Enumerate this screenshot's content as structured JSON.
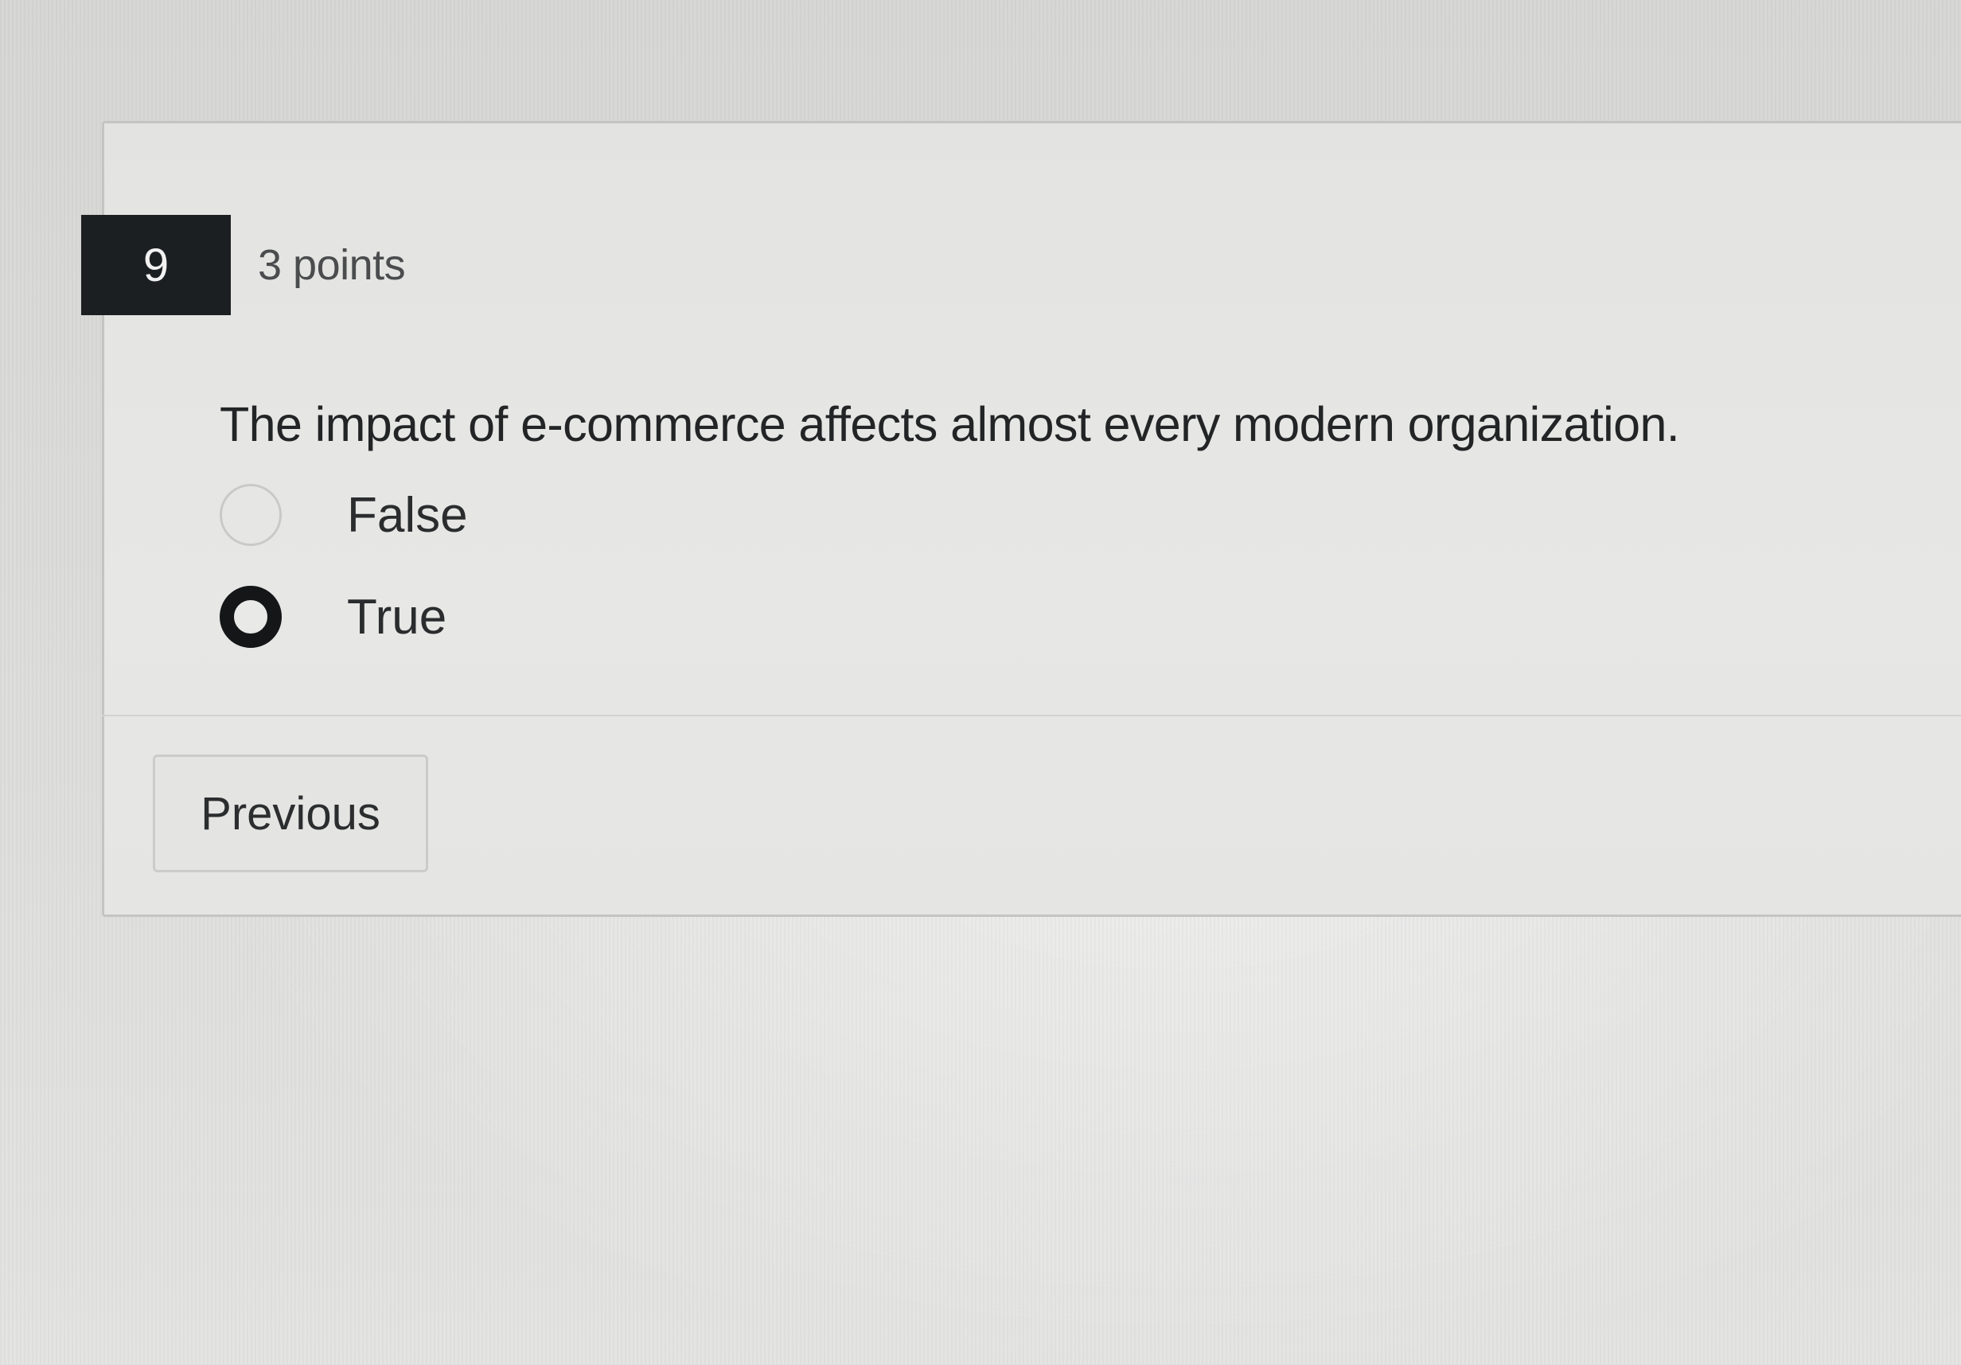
{
  "question": {
    "number": "9",
    "points": "3 points",
    "text": "The impact of e-commerce affects almost every modern organization.",
    "options": [
      {
        "label": "False",
        "selected": false
      },
      {
        "label": "True",
        "selected": true
      }
    ]
  },
  "navigation": {
    "previous_label": "Previous"
  },
  "colors": {
    "number_badge_bg": "#1c1f22",
    "selected_radio": "#141618"
  }
}
